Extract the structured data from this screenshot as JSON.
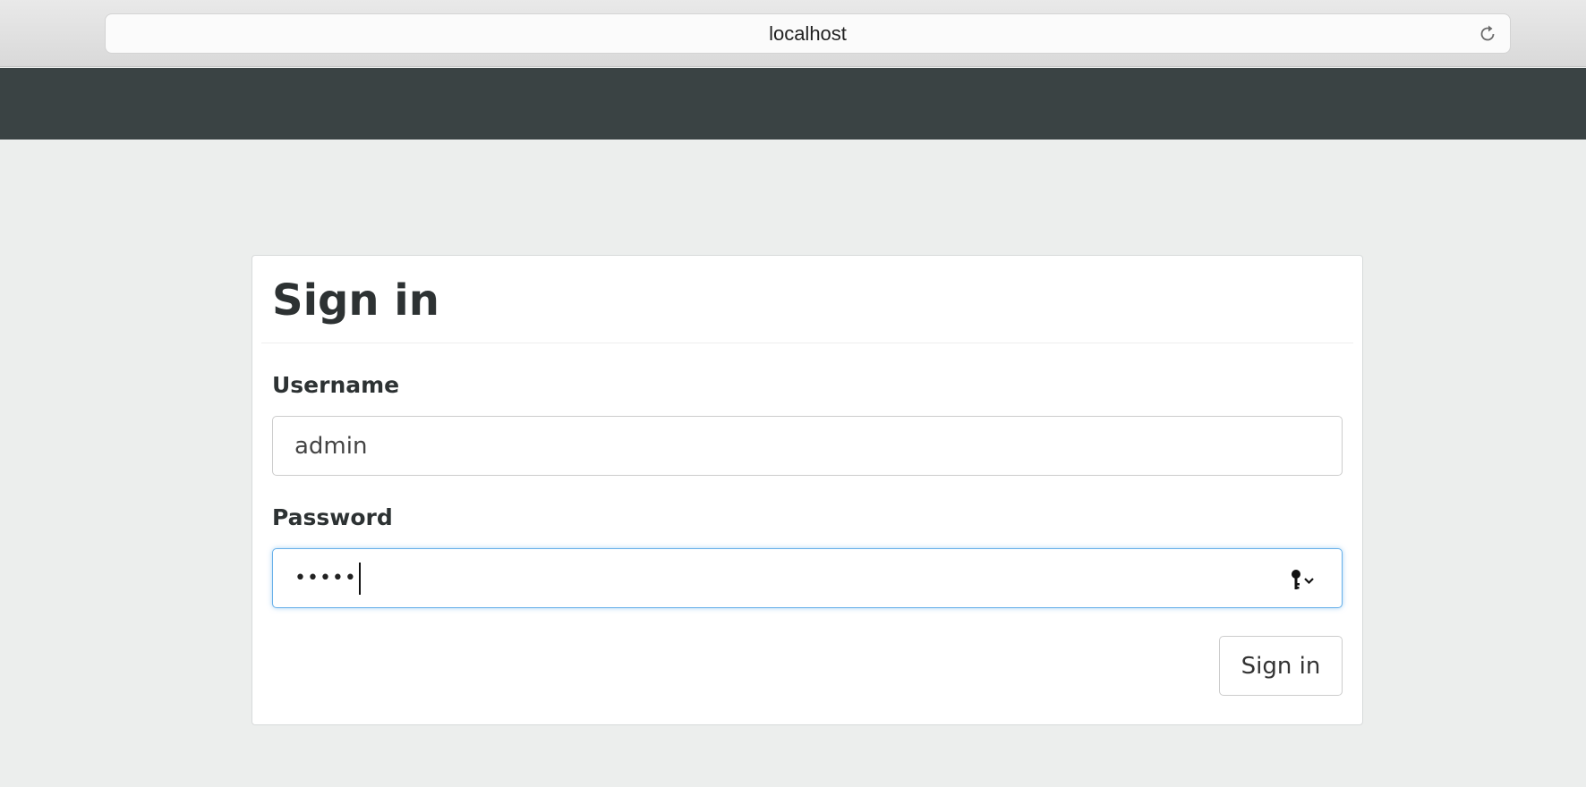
{
  "browser": {
    "address": "localhost",
    "reload_icon": "reload-icon"
  },
  "navbar": {
    "color": "#3a4344"
  },
  "signin_form": {
    "title": "Sign in",
    "username_label": "Username",
    "username_value": "admin",
    "password_label": "Password",
    "password_value": "•••••",
    "password_icon": "key-autofill-icon",
    "submit_label": "Sign in"
  },
  "colors": {
    "page_background": "#eceeed",
    "focus_ring": "#66afe9"
  }
}
